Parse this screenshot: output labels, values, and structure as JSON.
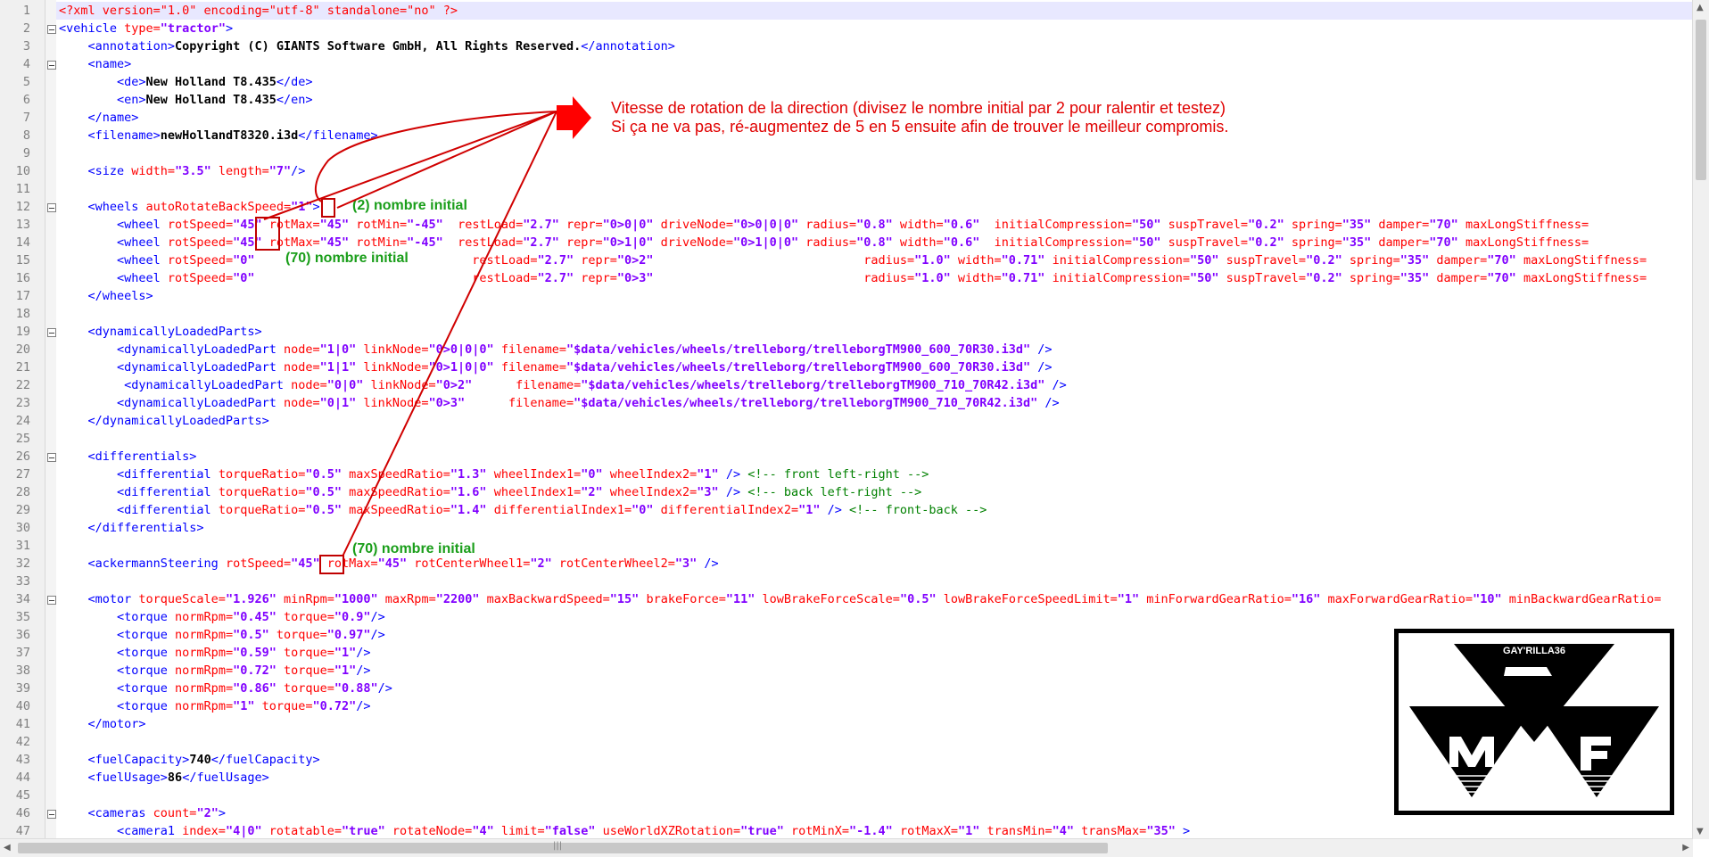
{
  "editor": {
    "line_numbers": [
      "1",
      "2",
      "3",
      "4",
      "5",
      "6",
      "7",
      "8",
      "9",
      "10",
      "11",
      "12",
      "13",
      "14",
      "15",
      "16",
      "17",
      "18",
      "19",
      "20",
      "21",
      "22",
      "23",
      "24",
      "25",
      "26",
      "27",
      "28",
      "29",
      "30",
      "31",
      "32",
      "33",
      "34",
      "35",
      "36",
      "37",
      "38",
      "39",
      "40",
      "41",
      "42",
      "43",
      "44",
      "45",
      "46",
      "47"
    ],
    "lines": [
      [
        [
          "pi",
          "<?xml version=\"1.0\" encoding=\"utf-8\" standalone=\"no\" ?>"
        ]
      ],
      [
        [
          "tg",
          "<vehicle "
        ],
        [
          "at",
          "type="
        ],
        [
          "av",
          "\"tractor\""
        ],
        [
          "tg",
          ">"
        ]
      ],
      [
        [
          "tg",
          "    <annotation>"
        ],
        [
          "tx",
          "Copyright (C) GIANTS Software GmbH, All Rights Reserved."
        ],
        [
          "tg",
          "</annotation>"
        ]
      ],
      [
        [
          "tg",
          "    <name>"
        ]
      ],
      [
        [
          "tg",
          "        <de>"
        ],
        [
          "tx",
          "New Holland T8.435"
        ],
        [
          "tg",
          "</de>"
        ]
      ],
      [
        [
          "tg",
          "        <en>"
        ],
        [
          "tx",
          "New Holland T8.435"
        ],
        [
          "tg",
          "</en>"
        ]
      ],
      [
        [
          "tg",
          "    </name>"
        ]
      ],
      [
        [
          "tg",
          "    <filename>"
        ],
        [
          "tx",
          "newHollandT8320.i3d"
        ],
        [
          "tg",
          "</filename>"
        ]
      ],
      [],
      [
        [
          "tg",
          "    <size "
        ],
        [
          "at",
          "width="
        ],
        [
          "av",
          "\"3.5\""
        ],
        [
          "at",
          " length="
        ],
        [
          "av",
          "\"7\""
        ],
        [
          "tg",
          "/>"
        ]
      ],
      [],
      [
        [
          "tg",
          "    <wheels "
        ],
        [
          "at",
          "autoRotateBackSpeed="
        ],
        [
          "av",
          "\"1\""
        ],
        [
          "tg",
          ">"
        ]
      ],
      [
        [
          "tg",
          "        <wheel "
        ],
        [
          "at",
          "rotSpeed="
        ],
        [
          "av",
          "\"45\""
        ],
        [
          "at",
          " rotMax="
        ],
        [
          "av",
          "\"45\""
        ],
        [
          "at",
          " rotMin="
        ],
        [
          "av",
          "\"-45\""
        ],
        [
          "at",
          "  restLoad="
        ],
        [
          "av",
          "\"2.7\""
        ],
        [
          "at",
          " repr="
        ],
        [
          "av",
          "\"0>0|0\""
        ],
        [
          "at",
          " driveNode="
        ],
        [
          "av",
          "\"0>0|0|0\""
        ],
        [
          "at",
          " radius="
        ],
        [
          "av",
          "\"0.8\""
        ],
        [
          "at",
          " width="
        ],
        [
          "av",
          "\"0.6\""
        ],
        [
          "at",
          "  initialCompression="
        ],
        [
          "av",
          "\"50\""
        ],
        [
          "at",
          " suspTravel="
        ],
        [
          "av",
          "\"0.2\""
        ],
        [
          "at",
          " spring="
        ],
        [
          "av",
          "\"35\""
        ],
        [
          "at",
          " damper="
        ],
        [
          "av",
          "\"70\""
        ],
        [
          "at",
          " maxLongStiffness="
        ]
      ],
      [
        [
          "tg",
          "        <wheel "
        ],
        [
          "at",
          "rotSpeed="
        ],
        [
          "av",
          "\"45\""
        ],
        [
          "at",
          " rotMax="
        ],
        [
          "av",
          "\"45\""
        ],
        [
          "at",
          " rotMin="
        ],
        [
          "av",
          "\"-45\""
        ],
        [
          "at",
          "  restLoad="
        ],
        [
          "av",
          "\"2.7\""
        ],
        [
          "at",
          " repr="
        ],
        [
          "av",
          "\"0>1|0\""
        ],
        [
          "at",
          " driveNode="
        ],
        [
          "av",
          "\"0>1|0|0\""
        ],
        [
          "at",
          " radius="
        ],
        [
          "av",
          "\"0.8\""
        ],
        [
          "at",
          " width="
        ],
        [
          "av",
          "\"0.6\""
        ],
        [
          "at",
          "  initialCompression="
        ],
        [
          "av",
          "\"50\""
        ],
        [
          "at",
          " suspTravel="
        ],
        [
          "av",
          "\"0.2\""
        ],
        [
          "at",
          " spring="
        ],
        [
          "av",
          "\"35\""
        ],
        [
          "at",
          " damper="
        ],
        [
          "av",
          "\"70\""
        ],
        [
          "at",
          " maxLongStiffness="
        ]
      ],
      [
        [
          "tg",
          "        <wheel "
        ],
        [
          "at",
          "rotSpeed="
        ],
        [
          "av",
          "\"0\""
        ],
        [
          "at",
          "                              restLoad="
        ],
        [
          "av",
          "\"2.7\""
        ],
        [
          "at",
          " repr="
        ],
        [
          "av",
          "\"0>2\""
        ],
        [
          "at",
          "                             radius="
        ],
        [
          "av",
          "\"1.0\""
        ],
        [
          "at",
          " width="
        ],
        [
          "av",
          "\"0.71\""
        ],
        [
          "at",
          " initialCompression="
        ],
        [
          "av",
          "\"50\""
        ],
        [
          "at",
          " suspTravel="
        ],
        [
          "av",
          "\"0.2\""
        ],
        [
          "at",
          " spring="
        ],
        [
          "av",
          "\"35\""
        ],
        [
          "at",
          " damper="
        ],
        [
          "av",
          "\"70\""
        ],
        [
          "at",
          " maxLongStiffness="
        ]
      ],
      [
        [
          "tg",
          "        <wheel "
        ],
        [
          "at",
          "rotSpeed="
        ],
        [
          "av",
          "\"0\""
        ],
        [
          "at",
          "                              restLoad="
        ],
        [
          "av",
          "\"2.7\""
        ],
        [
          "at",
          " repr="
        ],
        [
          "av",
          "\"0>3\""
        ],
        [
          "at",
          "                             radius="
        ],
        [
          "av",
          "\"1.0\""
        ],
        [
          "at",
          " width="
        ],
        [
          "av",
          "\"0.71\""
        ],
        [
          "at",
          " initialCompression="
        ],
        [
          "av",
          "\"50\""
        ],
        [
          "at",
          " suspTravel="
        ],
        [
          "av",
          "\"0.2\""
        ],
        [
          "at",
          " spring="
        ],
        [
          "av",
          "\"35\""
        ],
        [
          "at",
          " damper="
        ],
        [
          "av",
          "\"70\""
        ],
        [
          "at",
          " maxLongStiffness="
        ]
      ],
      [
        [
          "tg",
          "    </wheels>"
        ]
      ],
      [],
      [
        [
          "tg",
          "    <dynamicallyLoadedParts>"
        ]
      ],
      [
        [
          "tg",
          "        <dynamicallyLoadedPart "
        ],
        [
          "at",
          "node="
        ],
        [
          "av",
          "\"1|0\""
        ],
        [
          "at",
          " linkNode="
        ],
        [
          "av",
          "\"0>0|0|0\""
        ],
        [
          "at",
          " filename="
        ],
        [
          "av",
          "\"$data/vehicles/wheels/trelleborg/trelleborgTM900_600_70R30.i3d\""
        ],
        [
          "tg",
          " />"
        ]
      ],
      [
        [
          "tg",
          "        <dynamicallyLoadedPart "
        ],
        [
          "at",
          "node="
        ],
        [
          "av",
          "\"1|1\""
        ],
        [
          "at",
          " linkNode="
        ],
        [
          "av",
          "\"0>1|0|0\""
        ],
        [
          "at",
          " filename="
        ],
        [
          "av",
          "\"$data/vehicles/wheels/trelleborg/trelleborgTM900_600_70R30.i3d\""
        ],
        [
          "tg",
          " />"
        ]
      ],
      [
        [
          "tg",
          "         <dynamicallyLoadedPart "
        ],
        [
          "at",
          "node="
        ],
        [
          "av",
          "\"0|0\""
        ],
        [
          "at",
          " linkNode="
        ],
        [
          "av",
          "\"0>2\""
        ],
        [
          "at",
          "      filename="
        ],
        [
          "av",
          "\"$data/vehicles/wheels/trelleborg/trelleborgTM900_710_70R42.i3d\""
        ],
        [
          "tg",
          " />"
        ]
      ],
      [
        [
          "tg",
          "        <dynamicallyLoadedPart "
        ],
        [
          "at",
          "node="
        ],
        [
          "av",
          "\"0|1\""
        ],
        [
          "at",
          " linkNode="
        ],
        [
          "av",
          "\"0>3\""
        ],
        [
          "at",
          "      filename="
        ],
        [
          "av",
          "\"$data/vehicles/wheels/trelleborg/trelleborgTM900_710_70R42.i3d\""
        ],
        [
          "tg",
          " />"
        ]
      ],
      [
        [
          "tg",
          "    </dynamicallyLoadedParts>"
        ]
      ],
      [],
      [
        [
          "tg",
          "    <differentials>"
        ]
      ],
      [
        [
          "tg",
          "        <differential "
        ],
        [
          "at",
          "torqueRatio="
        ],
        [
          "av",
          "\"0.5\""
        ],
        [
          "at",
          " maxSpeedRatio="
        ],
        [
          "av",
          "\"1.3\""
        ],
        [
          "at",
          " wheelIndex1="
        ],
        [
          "av",
          "\"0\""
        ],
        [
          "at",
          " wheelIndex2="
        ],
        [
          "av",
          "\"1\""
        ],
        [
          "tg",
          " /> "
        ],
        [
          "cm",
          "<!-- front left-right -->"
        ]
      ],
      [
        [
          "tg",
          "        <differential "
        ],
        [
          "at",
          "torqueRatio="
        ],
        [
          "av",
          "\"0.5\""
        ],
        [
          "at",
          " maxSpeedRatio="
        ],
        [
          "av",
          "\"1.6\""
        ],
        [
          "at",
          " wheelIndex1="
        ],
        [
          "av",
          "\"2\""
        ],
        [
          "at",
          " wheelIndex2="
        ],
        [
          "av",
          "\"3\""
        ],
        [
          "tg",
          " /> "
        ],
        [
          "cm",
          "<!-- back left-right -->"
        ]
      ],
      [
        [
          "tg",
          "        <differential "
        ],
        [
          "at",
          "torqueRatio="
        ],
        [
          "av",
          "\"0.5\""
        ],
        [
          "at",
          " maxSpeedRatio="
        ],
        [
          "av",
          "\"1.4\""
        ],
        [
          "at",
          " differentialIndex1="
        ],
        [
          "av",
          "\"0\""
        ],
        [
          "at",
          " differentialIndex2="
        ],
        [
          "av",
          "\"1\""
        ],
        [
          "tg",
          " /> "
        ],
        [
          "cm",
          "<!-- front-back -->"
        ]
      ],
      [
        [
          "tg",
          "    </differentials>"
        ]
      ],
      [],
      [
        [
          "tg",
          "    <ackermannSteering "
        ],
        [
          "at",
          "rotSpeed="
        ],
        [
          "av",
          "\"45\""
        ],
        [
          "at",
          " rotMax="
        ],
        [
          "av",
          "\"45\""
        ],
        [
          "at",
          " rotCenterWheel1="
        ],
        [
          "av",
          "\"2\""
        ],
        [
          "at",
          " rotCenterWheel2="
        ],
        [
          "av",
          "\"3\""
        ],
        [
          "tg",
          " />"
        ]
      ],
      [],
      [
        [
          "tg",
          "    <motor "
        ],
        [
          "at",
          "torqueScale="
        ],
        [
          "av",
          "\"1.926\""
        ],
        [
          "at",
          " minRpm="
        ],
        [
          "av",
          "\"1000\""
        ],
        [
          "at",
          " maxRpm="
        ],
        [
          "av",
          "\"2200\""
        ],
        [
          "at",
          " maxBackwardSpeed="
        ],
        [
          "av",
          "\"15\""
        ],
        [
          "at",
          " brakeForce="
        ],
        [
          "av",
          "\"11\""
        ],
        [
          "at",
          " lowBrakeForceScale="
        ],
        [
          "av",
          "\"0.5\""
        ],
        [
          "at",
          " lowBrakeForceSpeedLimit="
        ],
        [
          "av",
          "\"1\""
        ],
        [
          "at",
          " minForwardGearRatio="
        ],
        [
          "av",
          "\"16\""
        ],
        [
          "at",
          " maxForwardGearRatio="
        ],
        [
          "av",
          "\"10\""
        ],
        [
          "at",
          " minBackwardGearRatio="
        ]
      ],
      [
        [
          "tg",
          "        <torque "
        ],
        [
          "at",
          "normRpm="
        ],
        [
          "av",
          "\"0.45\""
        ],
        [
          "at",
          " torque="
        ],
        [
          "av",
          "\"0.9\""
        ],
        [
          "tg",
          "/>"
        ]
      ],
      [
        [
          "tg",
          "        <torque "
        ],
        [
          "at",
          "normRpm="
        ],
        [
          "av",
          "\"0.5\""
        ],
        [
          "at",
          " torque="
        ],
        [
          "av",
          "\"0.97\""
        ],
        [
          "tg",
          "/>"
        ]
      ],
      [
        [
          "tg",
          "        <torque "
        ],
        [
          "at",
          "normRpm="
        ],
        [
          "av",
          "\"0.59\""
        ],
        [
          "at",
          " torque="
        ],
        [
          "av",
          "\"1\""
        ],
        [
          "tg",
          "/>"
        ]
      ],
      [
        [
          "tg",
          "        <torque "
        ],
        [
          "at",
          "normRpm="
        ],
        [
          "av",
          "\"0.72\""
        ],
        [
          "at",
          " torque="
        ],
        [
          "av",
          "\"1\""
        ],
        [
          "tg",
          "/>"
        ]
      ],
      [
        [
          "tg",
          "        <torque "
        ],
        [
          "at",
          "normRpm="
        ],
        [
          "av",
          "\"0.86\""
        ],
        [
          "at",
          " torque="
        ],
        [
          "av",
          "\"0.88\""
        ],
        [
          "tg",
          "/>"
        ]
      ],
      [
        [
          "tg",
          "        <torque "
        ],
        [
          "at",
          "normRpm="
        ],
        [
          "av",
          "\"1\""
        ],
        [
          "at",
          " torque="
        ],
        [
          "av",
          "\"0.72\""
        ],
        [
          "tg",
          "/>"
        ]
      ],
      [
        [
          "tg",
          "    </motor>"
        ]
      ],
      [],
      [
        [
          "tg",
          "    <fuelCapacity>"
        ],
        [
          "tx",
          "740"
        ],
        [
          "tg",
          "</fuelCapacity>"
        ]
      ],
      [
        [
          "tg",
          "    <fuelUsage>"
        ],
        [
          "tx",
          "86"
        ],
        [
          "tg",
          "</fuelUsage>"
        ]
      ],
      [],
      [
        [
          "tg",
          "    <cameras "
        ],
        [
          "at",
          "count="
        ],
        [
          "av",
          "\"2\""
        ],
        [
          "tg",
          ">"
        ]
      ],
      [
        [
          "tg",
          "        <camera1 "
        ],
        [
          "at",
          "index="
        ],
        [
          "av",
          "\"4|0\""
        ],
        [
          "at",
          " rotatable="
        ],
        [
          "av",
          "\"true\""
        ],
        [
          "at",
          " rotateNode="
        ],
        [
          "av",
          "\"4\""
        ],
        [
          "at",
          " limit="
        ],
        [
          "av",
          "\"false\""
        ],
        [
          "at",
          " useWorldXZRotation="
        ],
        [
          "av",
          "\"true\""
        ],
        [
          "at",
          " rotMinX="
        ],
        [
          "av",
          "\"-1.4\""
        ],
        [
          "at",
          " rotMaxX="
        ],
        [
          "av",
          "\"1\""
        ],
        [
          "at",
          " transMin="
        ],
        [
          "av",
          "\"4\""
        ],
        [
          "at",
          " transMax="
        ],
        [
          "av",
          "\"35\""
        ],
        [
          "tg",
          " >"
        ]
      ]
    ]
  },
  "annotations": {
    "instruction_line1": "Vitesse de rotation de la direction (divisez le nombre initial par 2 pour ralentir et testez)",
    "instruction_line2": "Si ça ne va pas, ré-augmentez de 5 en 5 ensuite afin de trouver le meilleur compromis.",
    "note_wheels": "(2)  nombre initial",
    "note_rotspeed": "(70) nombre initial",
    "note_ackermann": "(70) nombre initial",
    "accent_red": "#e00000",
    "accent_green": "#1a9e1a"
  },
  "logo": {
    "caption": "GAY'RILLA36",
    "letter_left": "M",
    "letter_right": "F",
    "icon": "massey-ferguson-triple-triangle-logo"
  },
  "scrollbars": {
    "up_arrow": "▲",
    "down_arrow": "▼",
    "left_arrow": "◀",
    "right_arrow": "▶",
    "grip": "|||"
  }
}
